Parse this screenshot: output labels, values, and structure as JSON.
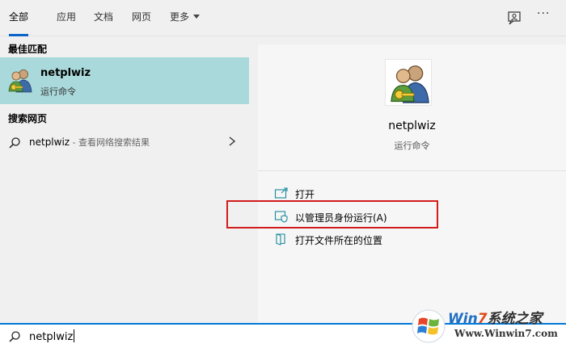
{
  "tabs": [
    {
      "label": "全部",
      "active": true
    },
    {
      "label": "应用",
      "active": false
    },
    {
      "label": "文档",
      "active": false
    },
    {
      "label": "网页",
      "active": false
    },
    {
      "label": "更多",
      "active": false
    }
  ],
  "top_icons": {
    "feedback": "feedback-icon",
    "more": "···"
  },
  "left": {
    "best_match_heading": "最佳匹配",
    "best_match": {
      "name": "netplwiz",
      "subtitle": "运行命令",
      "icon": "users-key-icon"
    },
    "web_heading": "搜索网页",
    "web_result": {
      "query": "netplwiz",
      "hint": " - 查看网络搜索结果"
    }
  },
  "right": {
    "title": "netplwiz",
    "subtitle": "运行命令",
    "actions": [
      {
        "label": "打开",
        "icon": "open-icon"
      },
      {
        "label": "以管理员身份运行(A)",
        "icon": "shield-icon"
      },
      {
        "label": "打开文件所在的位置",
        "icon": "folder-icon"
      }
    ]
  },
  "search": {
    "value": "netplwiz"
  },
  "watermark": {
    "brand_a": "Win",
    "brand_b": "7",
    "brand_c": "系统之家",
    "url": "Www.Winwin7.com"
  },
  "colors": {
    "accent": "#0078d7",
    "selected_row": "#a9d9db",
    "highlight_box": "#d21b1b"
  }
}
